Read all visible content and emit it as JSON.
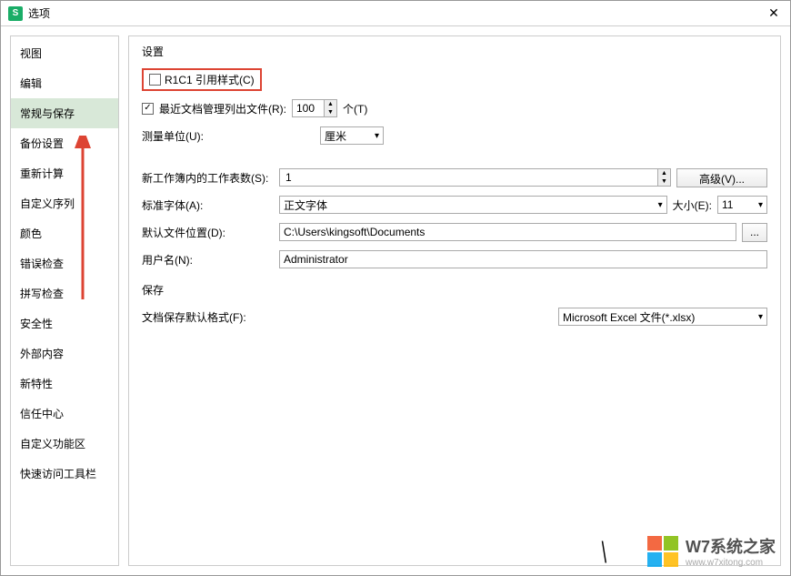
{
  "titlebar": {
    "title": "选项",
    "close": "✕"
  },
  "sidebar": {
    "items": [
      {
        "label": "视图"
      },
      {
        "label": "编辑"
      },
      {
        "label": "常规与保存",
        "active": true
      },
      {
        "label": "备份设置"
      },
      {
        "label": "重新计算"
      },
      {
        "label": "自定义序列"
      },
      {
        "label": "颜色"
      },
      {
        "label": "错误检查"
      },
      {
        "label": "拼写检查"
      },
      {
        "label": "安全性"
      },
      {
        "label": "外部内容"
      },
      {
        "label": "新特性"
      },
      {
        "label": "信任中心"
      },
      {
        "label": "自定义功能区"
      },
      {
        "label": "快速访问工具栏"
      }
    ]
  },
  "section_settings": "设置",
  "r1c1": {
    "label": "R1C1 引用样式(C)",
    "checked": false
  },
  "recent_docs": {
    "label": "最近文档管理列出文件(R):",
    "value": "100",
    "suffix": "个(T)",
    "checked": true
  },
  "unit": {
    "label": "测量单位(U):",
    "value": "厘米"
  },
  "sheets": {
    "label": "新工作簿内的工作表数(S):",
    "value": "1",
    "advanced_btn": "高级(V)..."
  },
  "font": {
    "label": "标准字体(A):",
    "value": "正文字体",
    "size_label": "大小(E):",
    "size_value": "11"
  },
  "path": {
    "label": "默认文件位置(D):",
    "value": "C:\\Users\\kingsoft\\Documents",
    "browse": "..."
  },
  "username": {
    "label": "用户名(N):",
    "value": "Administrator"
  },
  "section_save": "保存",
  "save_format": {
    "label": "文档保存默认格式(F):",
    "value": "Microsoft Excel 文件(*.xlsx)"
  },
  "watermark": {
    "main": "W7系统之家",
    "sub": "www.w7xitong.com"
  }
}
